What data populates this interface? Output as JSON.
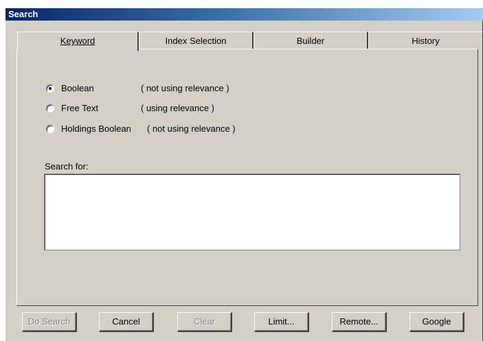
{
  "window": {
    "title": "Search"
  },
  "tabs": [
    {
      "label": "Keyword",
      "active": true
    },
    {
      "label": "Index Selection",
      "active": false
    },
    {
      "label": "Builder",
      "active": false
    },
    {
      "label": "History",
      "active": false
    }
  ],
  "search_modes": [
    {
      "label": "Boolean",
      "note": "( not using relevance )",
      "selected": true
    },
    {
      "label": "Free Text",
      "note": "( using relevance )",
      "selected": false
    },
    {
      "label": "Holdings Boolean",
      "note": "( not using relevance )",
      "selected": false
    }
  ],
  "search_for": {
    "label": "Search for:",
    "value": ""
  },
  "buttons": {
    "do_search": {
      "label": "Do Search",
      "enabled": false
    },
    "cancel": {
      "label": "Cancel",
      "enabled": true
    },
    "clear": {
      "label": "Clear",
      "enabled": false
    },
    "limit": {
      "label": "Limit...",
      "enabled": true
    },
    "remote": {
      "label": "Remote...",
      "enabled": true
    },
    "google": {
      "label": "Google",
      "enabled": true
    }
  }
}
